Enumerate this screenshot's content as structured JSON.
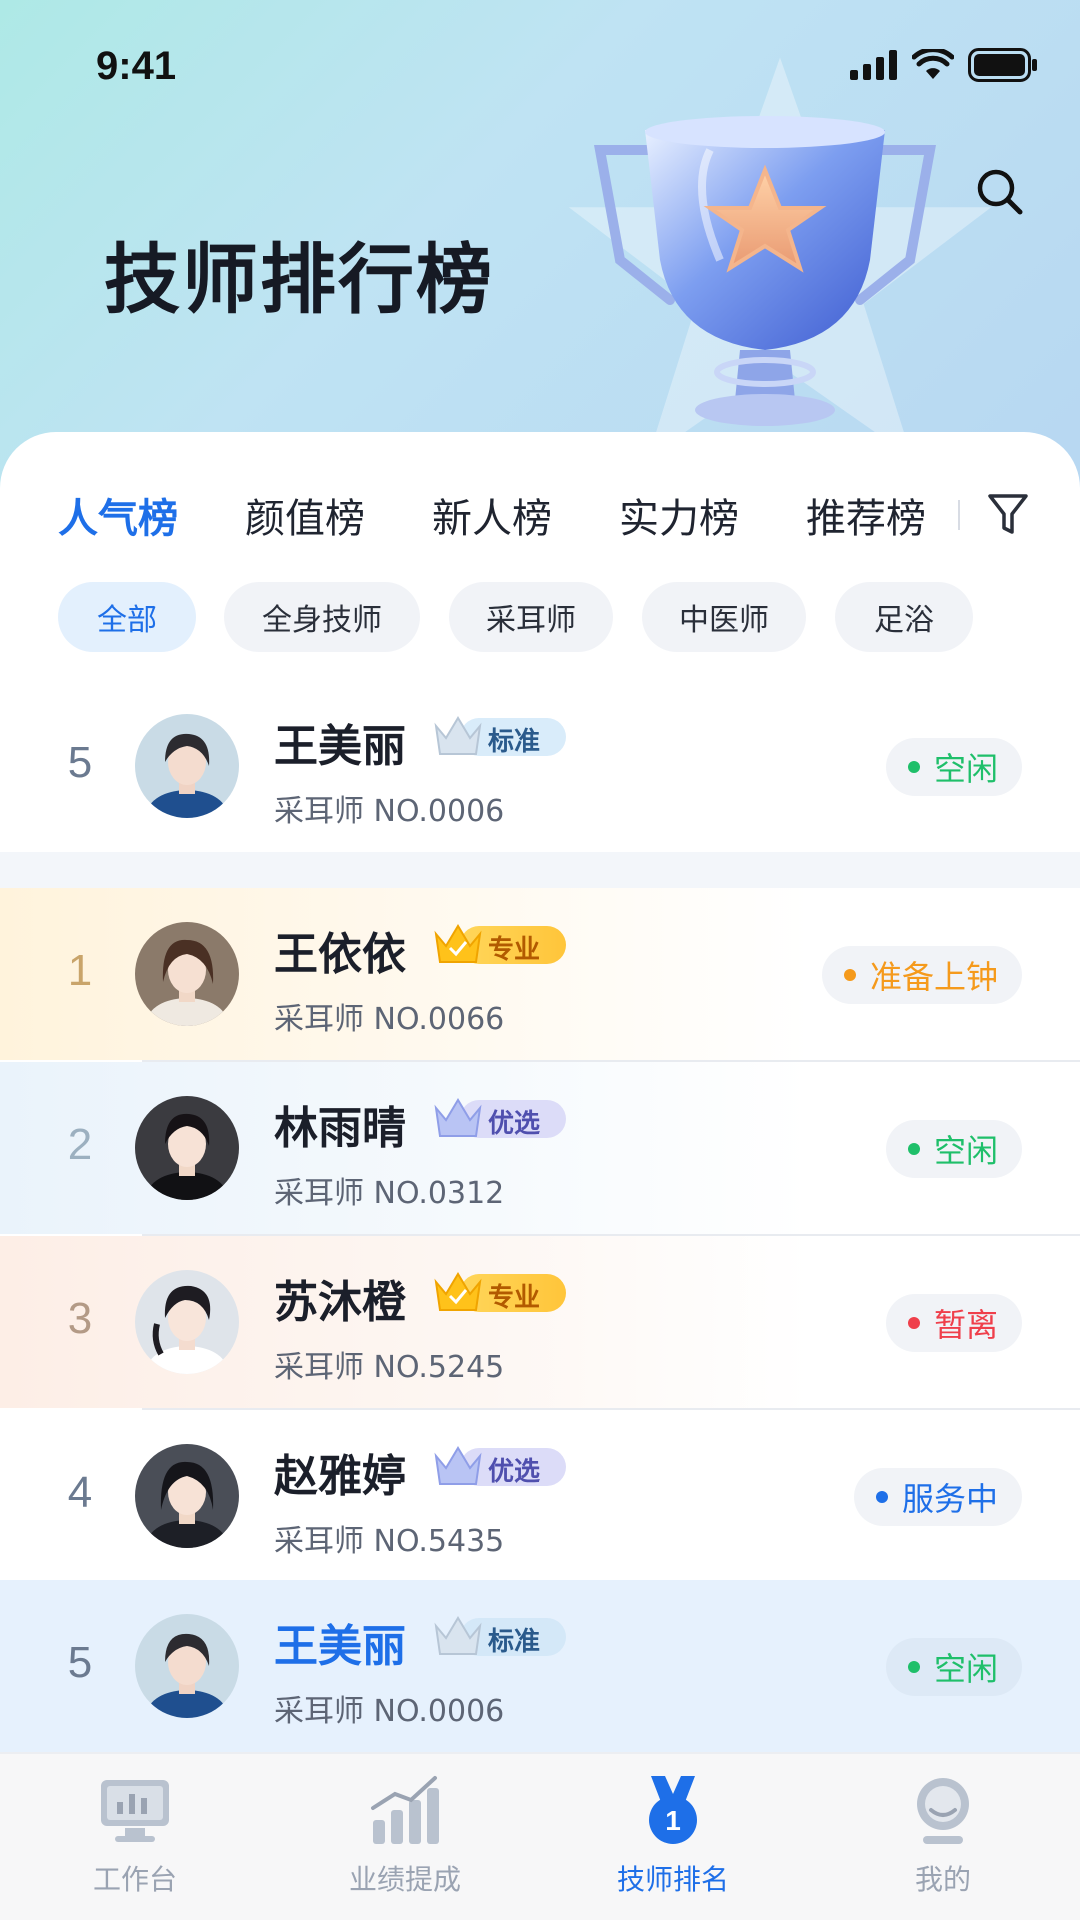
{
  "status_bar": {
    "time": "9:41"
  },
  "header": {
    "title": "技师排行榜"
  },
  "tabs": [
    {
      "label": "人气榜",
      "active": true
    },
    {
      "label": "颜值榜",
      "active": false
    },
    {
      "label": "新人榜",
      "active": false
    },
    {
      "label": "实力榜",
      "active": false
    },
    {
      "label": "推荐榜",
      "active": false
    }
  ],
  "chips": [
    {
      "label": "全部",
      "active": true
    },
    {
      "label": "全身技师",
      "active": false
    },
    {
      "label": "采耳师",
      "active": false
    },
    {
      "label": "中医师",
      "active": false
    },
    {
      "label": "足浴",
      "active": false
    }
  ],
  "pinned": {
    "rank": "5",
    "name": "王美丽",
    "badge": "标准",
    "subtitle": "采耳师 NO.0006",
    "status": "空闲"
  },
  "list": [
    {
      "rank": "1",
      "name": "王依依",
      "badge": "专业",
      "subtitle": "采耳师 NO.0066",
      "status": "准备上钟"
    },
    {
      "rank": "2",
      "name": "林雨晴",
      "badge": "优选",
      "subtitle": "采耳师 NO.0312",
      "status": "空闲"
    },
    {
      "rank": "3",
      "name": "苏沐橙",
      "badge": "专业",
      "subtitle": "采耳师 NO.5245",
      "status": "暂离"
    },
    {
      "rank": "4",
      "name": "赵雅婷",
      "badge": "优选",
      "subtitle": "采耳师 NO.5435",
      "status": "服务中"
    },
    {
      "rank": "5",
      "name": "王美丽",
      "badge": "标准",
      "subtitle": "采耳师 NO.0006",
      "status": "空闲"
    }
  ],
  "tabbar": [
    {
      "label": "工作台",
      "icon": "monitor-icon",
      "active": false
    },
    {
      "label": "业绩提成",
      "icon": "bar-chart-icon",
      "active": false
    },
    {
      "label": "技师排名",
      "icon": "medal-icon",
      "active": true
    },
    {
      "label": "我的",
      "icon": "profile-icon",
      "active": false
    }
  ],
  "colors": {
    "accent": "#1e6fe8",
    "status_idle": "#1fbf6a",
    "status_ready": "#f59a1c",
    "status_away": "#ef3f4b",
    "status_serving": "#1e6fe8"
  }
}
